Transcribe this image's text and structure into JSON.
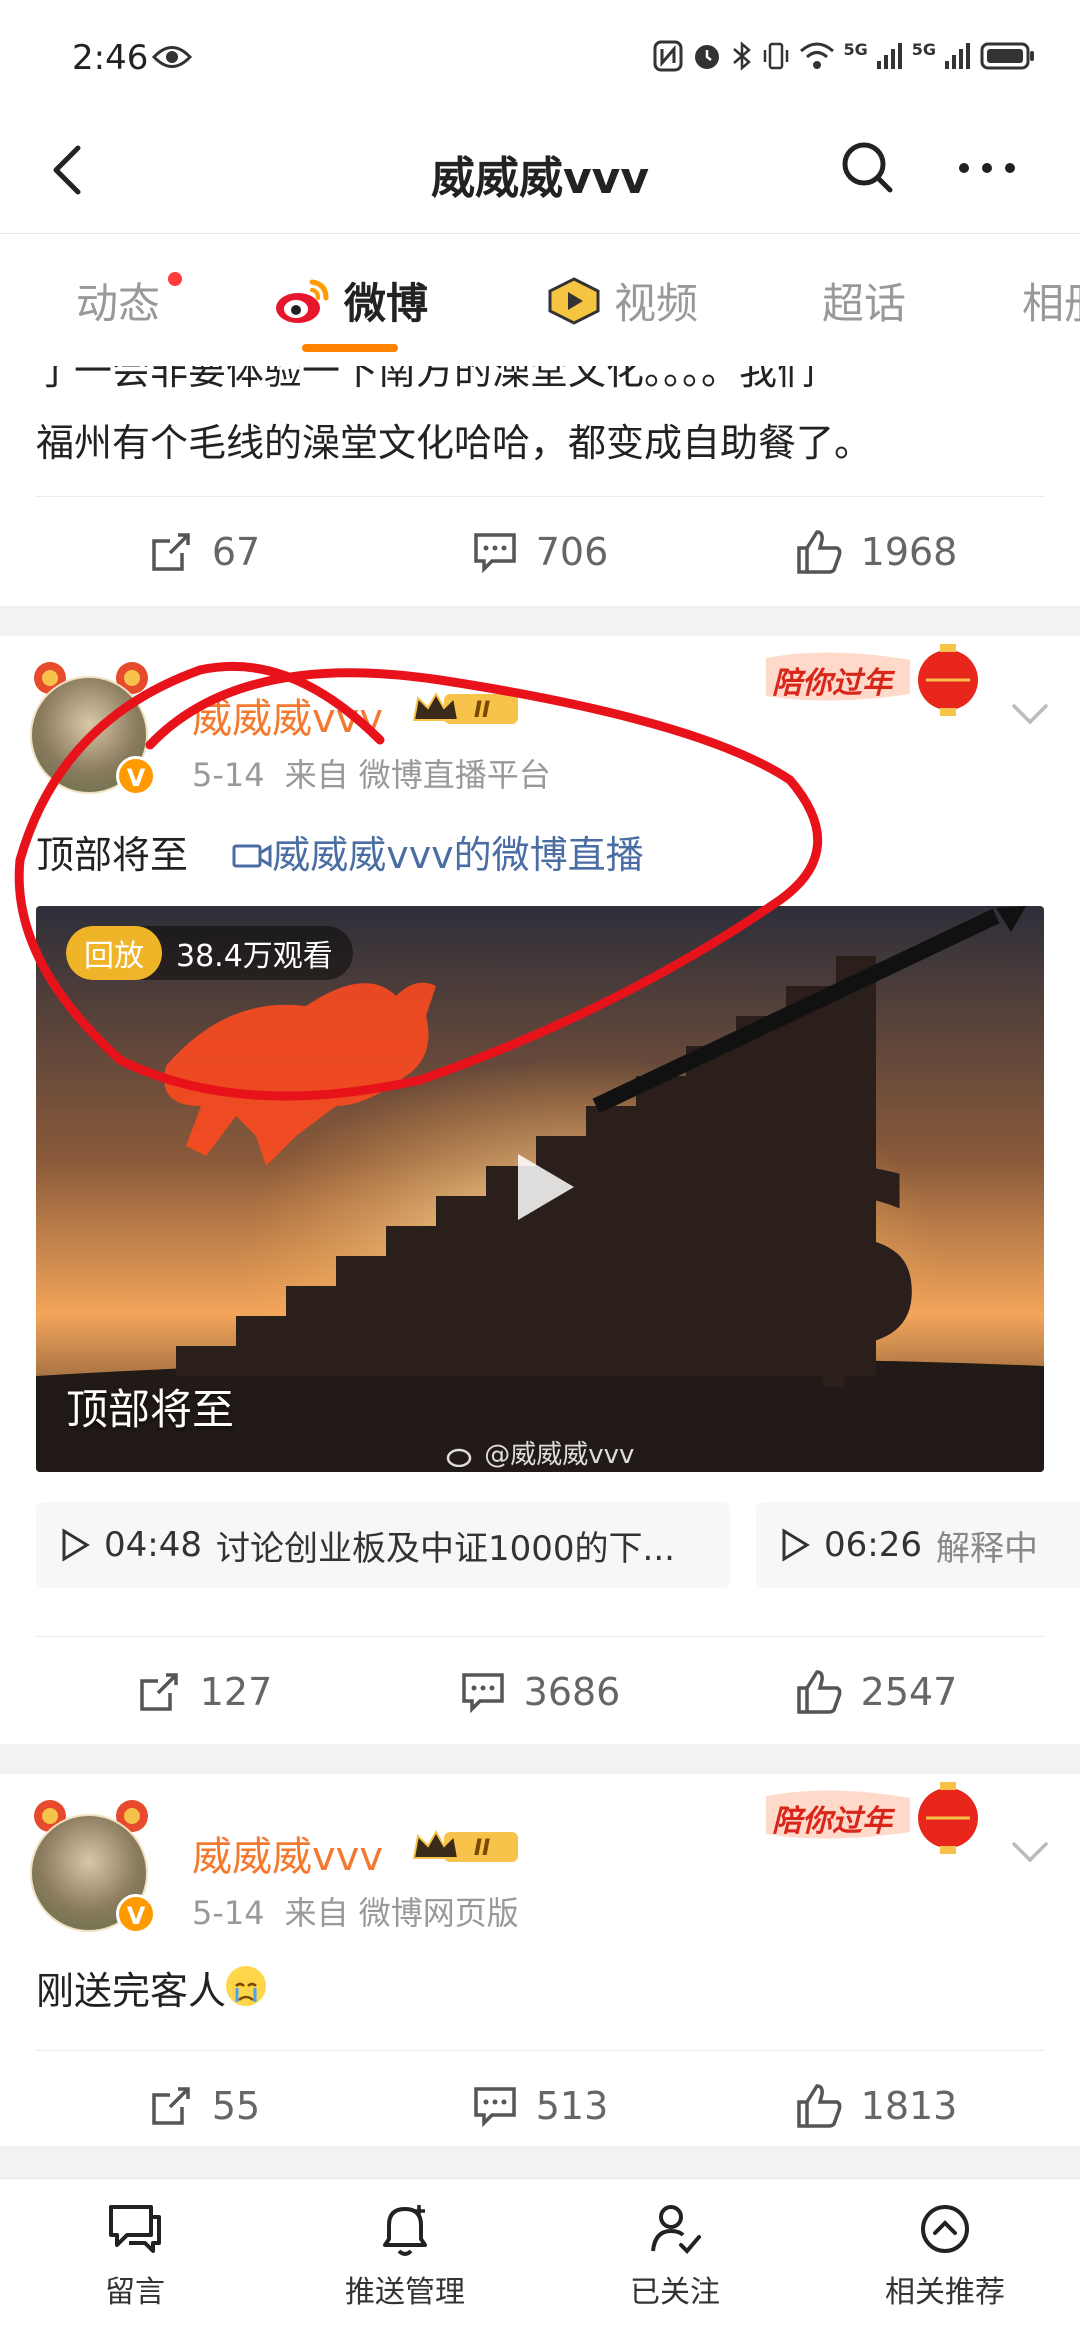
{
  "status_bar": {
    "time": "2:46",
    "network_a": "5G",
    "network_b": "5G"
  },
  "header": {
    "title": "威威威vvv"
  },
  "tabs": [
    {
      "label": "动态",
      "has_dot": true
    },
    {
      "label": "微博",
      "active": true
    },
    {
      "label": "视频"
    },
    {
      "label": "超话"
    },
    {
      "label": "相册"
    }
  ],
  "prev_post": {
    "text_line1": "了一会非要体验一下南方的澡堂文化。。。。我们",
    "text_line2": "福州有个毛线的澡堂文化哈哈，都变成自助餐了。",
    "reposts": "67",
    "comments": "706",
    "likes": "1968"
  },
  "post1": {
    "user_name": "威威威vvv",
    "level": "II",
    "date": "5-14",
    "source": "来自 微博直播平台",
    "badge": "陪你过年",
    "text": "顶部将至",
    "live_link": "威威威vvv的微博直播",
    "video": {
      "replay_label": "回放",
      "views": "38.4万观看",
      "caption": "顶部将至",
      "watermark": "@威威威vvv"
    },
    "chapters": [
      {
        "time": "04:48",
        "title": "讨论创业板及中证1000的下..."
      },
      {
        "time": "06:26",
        "title": "解释中"
      }
    ],
    "reposts": "127",
    "comments": "3686",
    "likes": "2547"
  },
  "post2": {
    "user_name": "威威威vvv",
    "level": "II",
    "date": "5-14",
    "source": "来自 微博网页版",
    "badge": "陪你过年",
    "text": "刚送完客人",
    "reposts": "55",
    "comments": "513",
    "likes": "1813"
  },
  "bottom_bar": [
    {
      "label": "留言",
      "icon": "message-icon"
    },
    {
      "label": "推送管理",
      "icon": "bell-icon"
    },
    {
      "label": "已关注",
      "icon": "user-check-icon"
    },
    {
      "label": "相关推荐",
      "icon": "chevron-up-circle-icon"
    }
  ],
  "colors": {
    "accent": "#ff8200",
    "username": "#f4792f",
    "link": "#4a6ea3",
    "annotation": "#e8121b"
  }
}
